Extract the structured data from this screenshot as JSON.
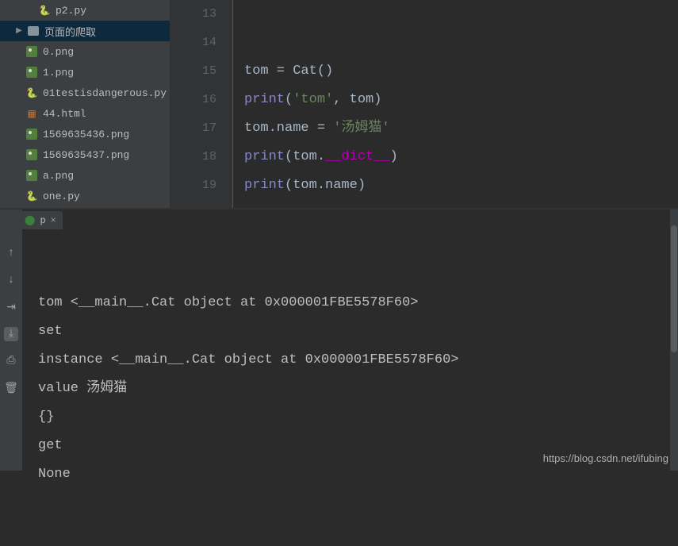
{
  "sidebar": {
    "items": [
      {
        "name": "p2.py",
        "kind": "python",
        "indent": 48
      },
      {
        "name": "页面的爬取",
        "kind": "folder",
        "indent": 18,
        "selected": true
      },
      {
        "name": "0.png",
        "kind": "png",
        "indent": 32
      },
      {
        "name": "1.png",
        "kind": "png",
        "indent": 32
      },
      {
        "name": "01testisdangerous.py",
        "kind": "python",
        "indent": 32
      },
      {
        "name": "44.html",
        "kind": "html",
        "indent": 32
      },
      {
        "name": "1569635436.png",
        "kind": "png",
        "indent": 32
      },
      {
        "name": "1569635437.png",
        "kind": "png",
        "indent": 32
      },
      {
        "name": "a.png",
        "kind": "png",
        "indent": 32
      },
      {
        "name": "one.py",
        "kind": "python",
        "indent": 32
      }
    ]
  },
  "editor": {
    "line_numbers": [
      "13",
      "14",
      "15",
      "16",
      "17",
      "18",
      "19"
    ],
    "code": {
      "l15": {
        "a": "tom = ",
        "b": "Cat",
        "c": "()"
      },
      "l16": {
        "a": "print",
        "b": "(",
        "c": "'tom'",
        "d": ", tom)"
      },
      "l17": {
        "a": "tom.name = ",
        "b": "'汤姆猫'"
      },
      "l18": {
        "a": "print",
        "b": "(tom.",
        "c": "__dict__",
        "d": ")"
      },
      "l19": {
        "a": "print",
        "b": "(tom.name)"
      }
    }
  },
  "console": {
    "tab_label": "p",
    "lines": [
      "tom <__main__.Cat object at 0x000001FBE5578F60>",
      "set",
      "instance <__main__.Cat object at 0x000001FBE5578F60>",
      "value 汤姆猫",
      "{}",
      "get",
      "None"
    ]
  },
  "watermark": "https://blog.csdn.net/ifubing"
}
